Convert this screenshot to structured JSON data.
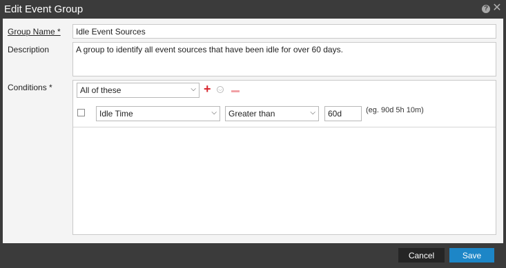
{
  "dialog": {
    "title": "Edit Event Group",
    "help_icon": "?",
    "close_icon": "✕"
  },
  "form": {
    "group_name_label": "Group Name *",
    "group_name_value": "Idle Event Sources",
    "description_label": "Description",
    "description_value": "A group to identify all event sources that have been idle for over 60 days.",
    "conditions_label": "Conditions *"
  },
  "conditions": {
    "match_mode": "All of these",
    "rows": [
      {
        "field": "Idle Time",
        "operator": "Greater than",
        "value": "60d",
        "hint": "(eg. 90d 5h 10m)"
      }
    ]
  },
  "footer": {
    "cancel_label": "Cancel",
    "save_label": "Save"
  },
  "colors": {
    "titlebar": "#3b3b3b",
    "body": "#f4f4f4",
    "save_button": "#1d86c7",
    "cancel_button": "#252525",
    "add_icon": "#d8262e",
    "remove_icon": "#f1a1a5"
  }
}
